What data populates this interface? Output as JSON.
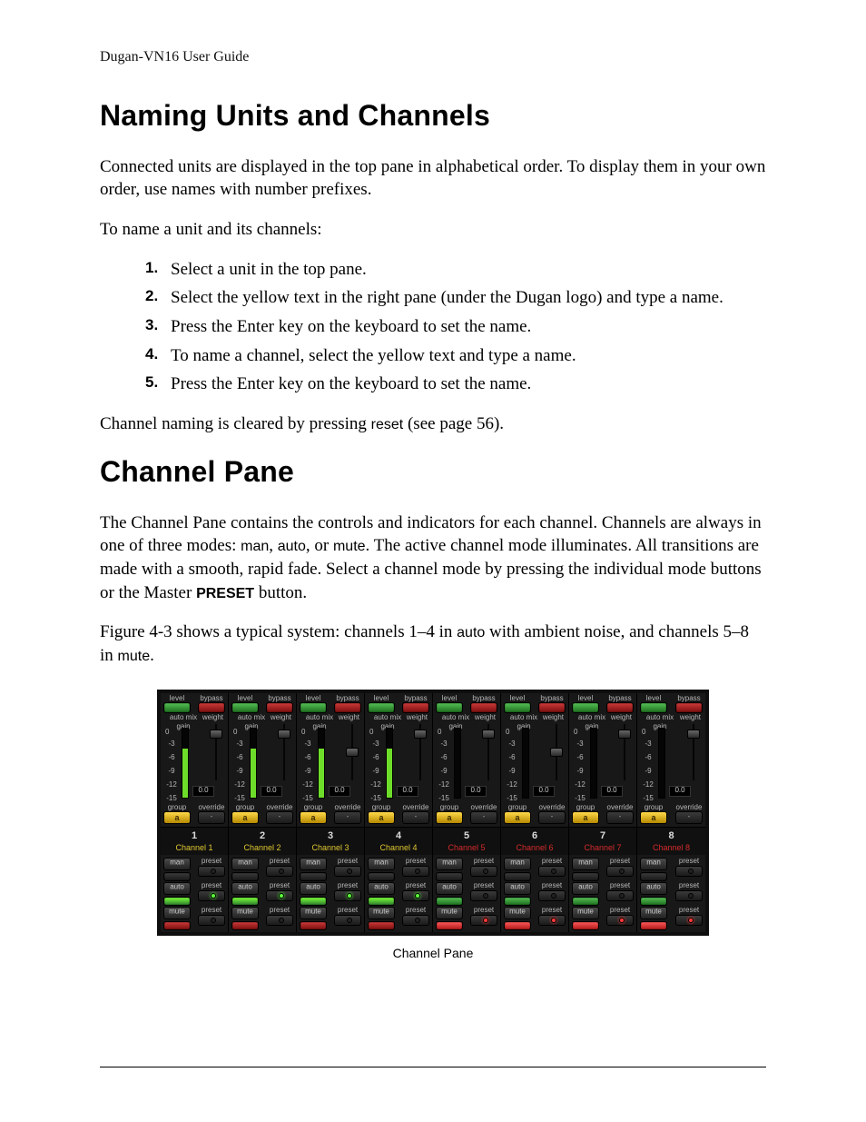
{
  "header": {
    "running": "Dugan-VN16 User Guide"
  },
  "section1": {
    "title": "Naming Units and Channels",
    "p1": "Connected units are displayed in the top pane in alphabetical order. To display them in your own order, use names with number prefixes.",
    "p2": "To name a unit and its channels:",
    "steps": [
      "Select a unit in the top pane.",
      "Select the yellow text in the right pane (under the Dugan logo) and type a name.",
      "Press the Enter key on the keyboard to set the name.",
      "To name a channel, select the yellow text and type a name.",
      "Press the Enter key on the keyboard to set the name."
    ],
    "p3_a": "Channel naming is cleared by pressing ",
    "p3_ui": "reset",
    "p3_b": " (see page 56)."
  },
  "section2": {
    "title": "Channel Pane",
    "p1_a": "The Channel Pane contains the controls and indicators for each channel. Channels are always in one of three modes: ",
    "p1_m1": "man",
    "p1_m2": "auto",
    "p1_m3": "mute",
    "p1_b": ". The active channel mode illuminates. All transitions are made with a smooth, rapid fade. Select a channel mode by pressing the individual mode buttons or the Master ",
    "p1_preset": "PRESET",
    "p1_c": " button.",
    "p2_a": "Figure 4-3 shows a typical system: channels 1–4 in ",
    "p2_auto": "auto",
    "p2_b": " with ambient noise, and channels 5–8 in ",
    "p2_mute": "mute",
    "p2_c": "."
  },
  "figure": {
    "caption": "Channel Pane",
    "labels": {
      "level": "level",
      "bypass": "bypass",
      "auto_mix_gain": "auto mix\ngain",
      "weight": "weight",
      "group": "group",
      "override": "override",
      "man": "man",
      "auto": "auto",
      "mute": "mute",
      "preset": "preset",
      "group_a": "a",
      "zero": "0"
    },
    "ticks": [
      "-3",
      "-6",
      "-9",
      "-12",
      "-15"
    ],
    "weight_value": "0.0",
    "channels": [
      {
        "num": "1",
        "name": "Channel 1",
        "mode": "auto",
        "gain_pct": 70,
        "knob_pos_pct": 12
      },
      {
        "num": "2",
        "name": "Channel 2",
        "mode": "auto",
        "gain_pct": 70,
        "knob_pos_pct": 12
      },
      {
        "num": "3",
        "name": "Channel 3",
        "mode": "auto",
        "gain_pct": 70,
        "knob_pos_pct": 35
      },
      {
        "num": "4",
        "name": "Channel 4",
        "mode": "auto",
        "gain_pct": 70,
        "knob_pos_pct": 12
      },
      {
        "num": "5",
        "name": "Channel 5",
        "mode": "mute",
        "gain_pct": 0,
        "knob_pos_pct": 12
      },
      {
        "num": "6",
        "name": "Channel 6",
        "mode": "mute",
        "gain_pct": 0,
        "knob_pos_pct": 35
      },
      {
        "num": "7",
        "name": "Channel 7",
        "mode": "mute",
        "gain_pct": 0,
        "knob_pos_pct": 12
      },
      {
        "num": "8",
        "name": "Channel 8",
        "mode": "mute",
        "gain_pct": 0,
        "knob_pos_pct": 12
      }
    ]
  }
}
